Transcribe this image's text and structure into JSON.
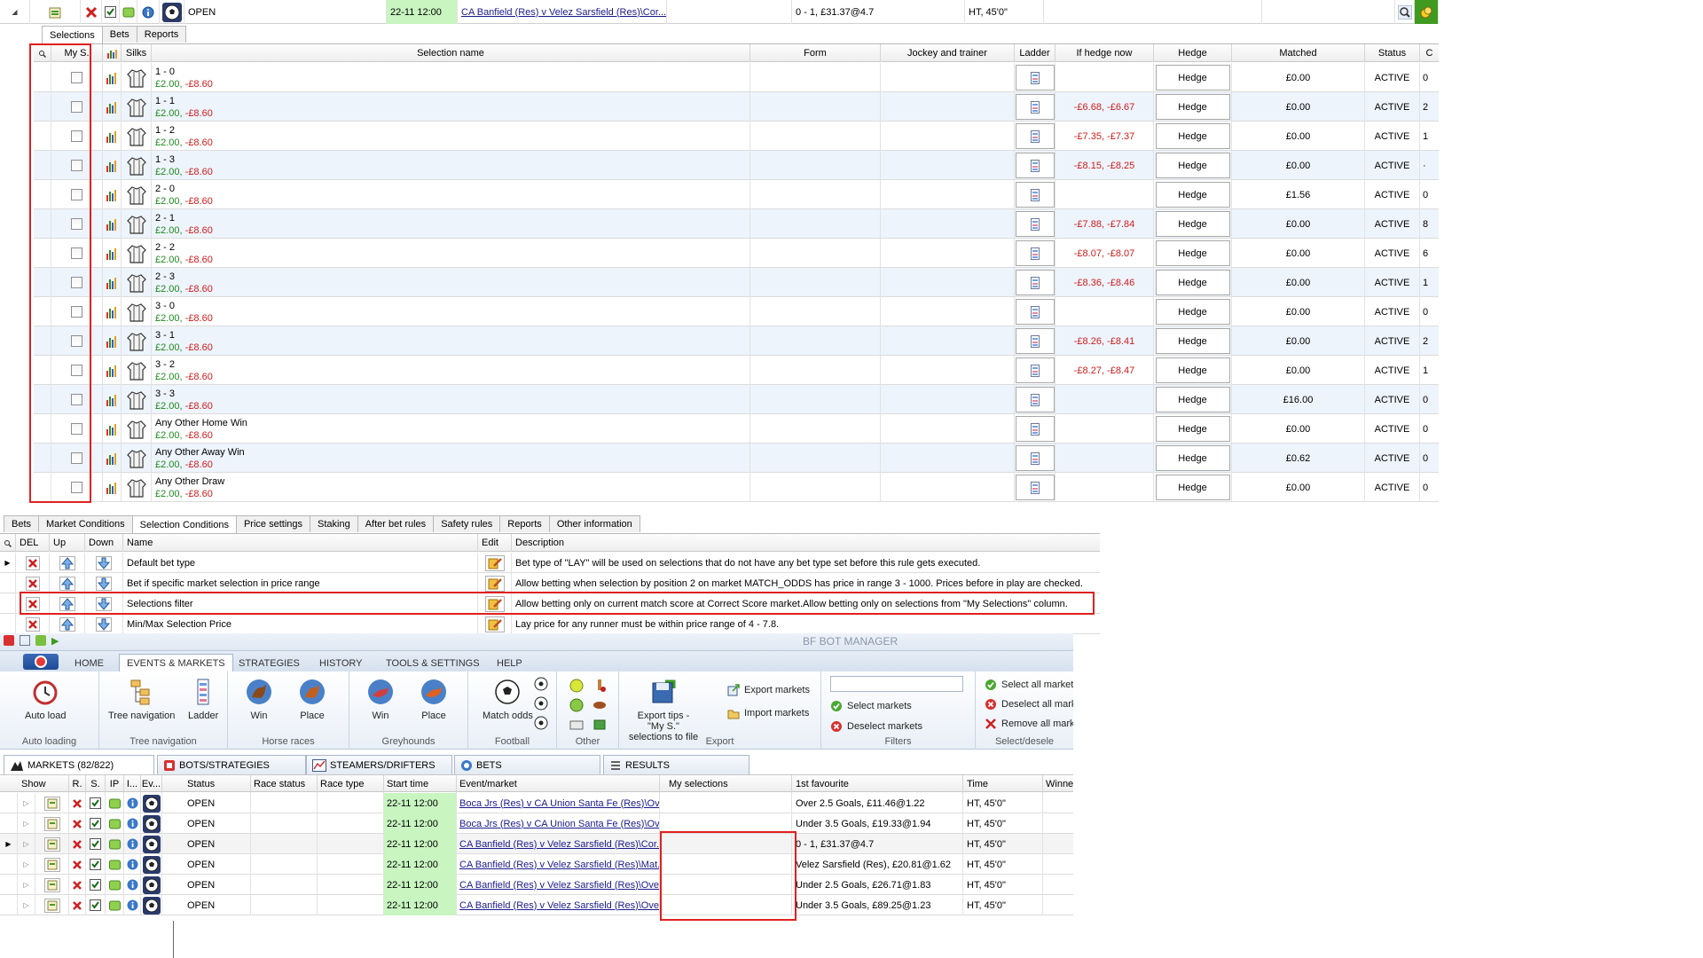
{
  "top_market_row": {
    "status": "OPEN",
    "start_time": "22-11 12:00",
    "event": "CA Banfield (Res) v Velez Sarsfield (Res)\\Cor...",
    "favourite": "0 - 1, £31.37@4.7",
    "time": "HT, 45'0\""
  },
  "selections_tabs": [
    "Selections",
    "Bets",
    "Reports"
  ],
  "selections_columns": {
    "search": "🔍",
    "my_s": "My S.",
    "silks": "Silks",
    "name": "Selection name",
    "form": "Form",
    "jockey": "Jockey and trainer",
    "ladder": "Ladder",
    "if_hedge": "If hedge now",
    "hedge": "Hedge",
    "matched": "Matched",
    "status": "Status",
    "extra": "C"
  },
  "selections": [
    {
      "name": "1 - 0",
      "price_pos": "£2.00,",
      "price_neg": "-£8.60",
      "hedge_now": "",
      "hedge": "Hedge",
      "matched": "£0.00",
      "status": "ACTIVE",
      "extra": "0"
    },
    {
      "name": "1 - 1",
      "price_pos": "£2.00,",
      "price_neg": "-£8.60",
      "hedge_now": "-£6.68, -£6.67",
      "hedge": "Hedge",
      "matched": "£0.00",
      "status": "ACTIVE",
      "extra": "2"
    },
    {
      "name": "1 - 2",
      "price_pos": "£2.00,",
      "price_neg": "-£8.60",
      "hedge_now": "-£7.35, -£7.37",
      "hedge": "Hedge",
      "matched": "£0.00",
      "status": "ACTIVE",
      "extra": "1"
    },
    {
      "name": "1 - 3",
      "price_pos": "£2.00,",
      "price_neg": "-£8.60",
      "hedge_now": "-£8.15, -£8.25",
      "hedge": "Hedge",
      "matched": "£0.00",
      "status": "ACTIVE",
      "extra": "·"
    },
    {
      "name": "2 - 0",
      "price_pos": "£2.00,",
      "price_neg": "-£8.60",
      "hedge_now": "",
      "hedge": "Hedge",
      "matched": "£1.56",
      "status": "ACTIVE",
      "extra": "0"
    },
    {
      "name": "2 - 1",
      "price_pos": "£2.00,",
      "price_neg": "-£8.60",
      "hedge_now": "-£7.88, -£7.84",
      "hedge": "Hedge",
      "matched": "£0.00",
      "status": "ACTIVE",
      "extra": "8"
    },
    {
      "name": "2 - 2",
      "price_pos": "£2.00,",
      "price_neg": "-£8.60",
      "hedge_now": "-£8.07, -£8.07",
      "hedge": "Hedge",
      "matched": "£0.00",
      "status": "ACTIVE",
      "extra": "6"
    },
    {
      "name": "2 - 3",
      "price_pos": "£2.00,",
      "price_neg": "-£8.60",
      "hedge_now": "-£8.36, -£8.46",
      "hedge": "Hedge",
      "matched": "£0.00",
      "status": "ACTIVE",
      "extra": "1"
    },
    {
      "name": "3 - 0",
      "price_pos": "£2.00,",
      "price_neg": "-£8.60",
      "hedge_now": "",
      "hedge": "Hedge",
      "matched": "£0.00",
      "status": "ACTIVE",
      "extra": "0"
    },
    {
      "name": "3 - 1",
      "price_pos": "£2.00,",
      "price_neg": "-£8.60",
      "hedge_now": "-£8.26, -£8.41",
      "hedge": "Hedge",
      "matched": "£0.00",
      "status": "ACTIVE",
      "extra": "2"
    },
    {
      "name": "3 - 2",
      "price_pos": "£2.00,",
      "price_neg": "-£8.60",
      "hedge_now": "-£8.27, -£8.47",
      "hedge": "Hedge",
      "matched": "£0.00",
      "status": "ACTIVE",
      "extra": "1"
    },
    {
      "name": "3 - 3",
      "price_pos": "£2.00,",
      "price_neg": "-£8.60",
      "hedge_now": "",
      "hedge": "Hedge",
      "matched": "£16.00",
      "status": "ACTIVE",
      "extra": "0"
    },
    {
      "name": "Any Other Home Win",
      "price_pos": "£2.00,",
      "price_neg": "-£8.60",
      "hedge_now": "",
      "hedge": "Hedge",
      "matched": "£0.00",
      "status": "ACTIVE",
      "extra": "0"
    },
    {
      "name": "Any Other Away Win",
      "price_pos": "£2.00,",
      "price_neg": "-£8.60",
      "hedge_now": "",
      "hedge": "Hedge",
      "matched": "£0.62",
      "status": "ACTIVE",
      "extra": "0"
    },
    {
      "name": "Any Other Draw",
      "price_pos": "£2.00,",
      "price_neg": "-£8.60",
      "hedge_now": "",
      "hedge": "Hedge",
      "matched": "£0.00",
      "status": "ACTIVE",
      "extra": "0"
    }
  ],
  "rules_tabs": [
    "Bets",
    "Market Conditions",
    "Selection Conditions",
    "Price settings",
    "Staking",
    "After bet rules",
    "Safety rules",
    "Reports",
    "Other information"
  ],
  "rules_columns": {
    "del": "DEL",
    "up": "Up",
    "down": "Down",
    "name": "Name",
    "edit": "Edit",
    "description": "Description"
  },
  "rules": [
    {
      "name": "Default bet type",
      "description": "Bet type of \"LAY\" will be used on selections that do not have any bet type set before this rule gets executed."
    },
    {
      "name": "Bet if specific market selection in price range",
      "description": "Allow betting when selection by position 2 on market MATCH_ODDS has price in range 3 - 1000. Prices before in play are checked."
    },
    {
      "name": "Selections filter",
      "description": "Allow betting only on current match score at Correct Score market.Allow betting only on selections from \"My Selections\" column."
    },
    {
      "name": "Min/Max Selection Price",
      "description": "Lay price  for any runner  must be within price range of 4 - 7.8."
    }
  ],
  "app_title": "BF BOT MANAGER",
  "ribbon_tabs": [
    "HOME",
    "EVENTS & MARKETS",
    "STRATEGIES",
    "HISTORY",
    "TOOLS & SETTINGS",
    "HELP"
  ],
  "ribbon": {
    "auto_load": "Auto load",
    "auto_loading": "Auto loading",
    "tree_nav": "Tree navigation",
    "ladder": "Ladder",
    "tree_navigation_group": "Tree navigation",
    "win": "Win",
    "place": "Place",
    "horse_races": "Horse races",
    "g_win": "Win",
    "g_place": "Place",
    "greyhounds": "Greyhounds",
    "match_odds": "Match odds",
    "football": "Football",
    "other": "Other",
    "export_tips": "Export tips - \"My S.\" selections to file",
    "export_markets": "Export markets",
    "import_markets": "Import markets",
    "export": "Export",
    "select_markets": "Select markets",
    "deselect_markets": "Deselect markets",
    "filters": "Filters",
    "select_all": "Select all market",
    "deselect_all": "Deselect all mark",
    "remove_all": "Remove all mark",
    "select_deselect": "Select/desele"
  },
  "bottom_tabs": [
    "MARKETS (82/822)",
    "BOTS/STRATEGIES",
    "STEAMERS/DRIFTERS",
    "BETS",
    "RESULTS"
  ],
  "markets_columns": {
    "show": "Show",
    "r": "R.",
    "s": "S.",
    "ip": "IP",
    "i": "I...",
    "ev": "Ev...",
    "status": "Status",
    "race_status": "Race status",
    "race_type": "Race type",
    "start_time": "Start time",
    "event": "Event/market",
    "my_sel": "My selections",
    "fav": "1st favourite",
    "time": "Time",
    "winner": "Winne"
  },
  "markets": [
    {
      "status": "OPEN",
      "start": "22-11 12:00",
      "event": "Boca Jrs (Res) v CA Union Santa Fe (Res)\\Ov...",
      "fav": "Over 2.5 Goals, £11.46@1.22",
      "time": "HT, 45'0\""
    },
    {
      "status": "OPEN",
      "start": "22-11 12:00",
      "event": "Boca Jrs (Res) v CA Union Santa Fe (Res)\\Ov...",
      "fav": "Under 3.5 Goals, £19.33@1.94",
      "time": "HT, 45'0\""
    },
    {
      "status": "OPEN",
      "start": "22-11 12:00",
      "event": "CA Banfield (Res) v Velez Sarsfield (Res)\\Cor...",
      "fav": "0 - 1, £31.37@4.7",
      "time": "HT, 45'0\""
    },
    {
      "status": "OPEN",
      "start": "22-11 12:00",
      "event": "CA Banfield (Res) v Velez Sarsfield (Res)\\Mat...",
      "fav": "Velez Sarsfield (Res), £20.81@1.62",
      "time": "HT, 45'0\""
    },
    {
      "status": "OPEN",
      "start": "22-11 12:00",
      "event": "CA Banfield (Res) v Velez Sarsfield (Res)\\Ove...",
      "fav": "Under 2.5 Goals, £26.71@1.83",
      "time": "HT, 45'0\""
    },
    {
      "status": "OPEN",
      "start": "22-11 12:00",
      "event": "CA Banfield (Res) v Velez Sarsfield (Res)\\Ove...",
      "fav": "Under 3.5 Goals, £89.25@1.23",
      "time": "HT, 45'0\""
    }
  ],
  "colors": {
    "positive": "#1f8a1f",
    "negative": "#d01c1c",
    "highlight": "#e02020",
    "time_bg": "#c8f5c0"
  }
}
